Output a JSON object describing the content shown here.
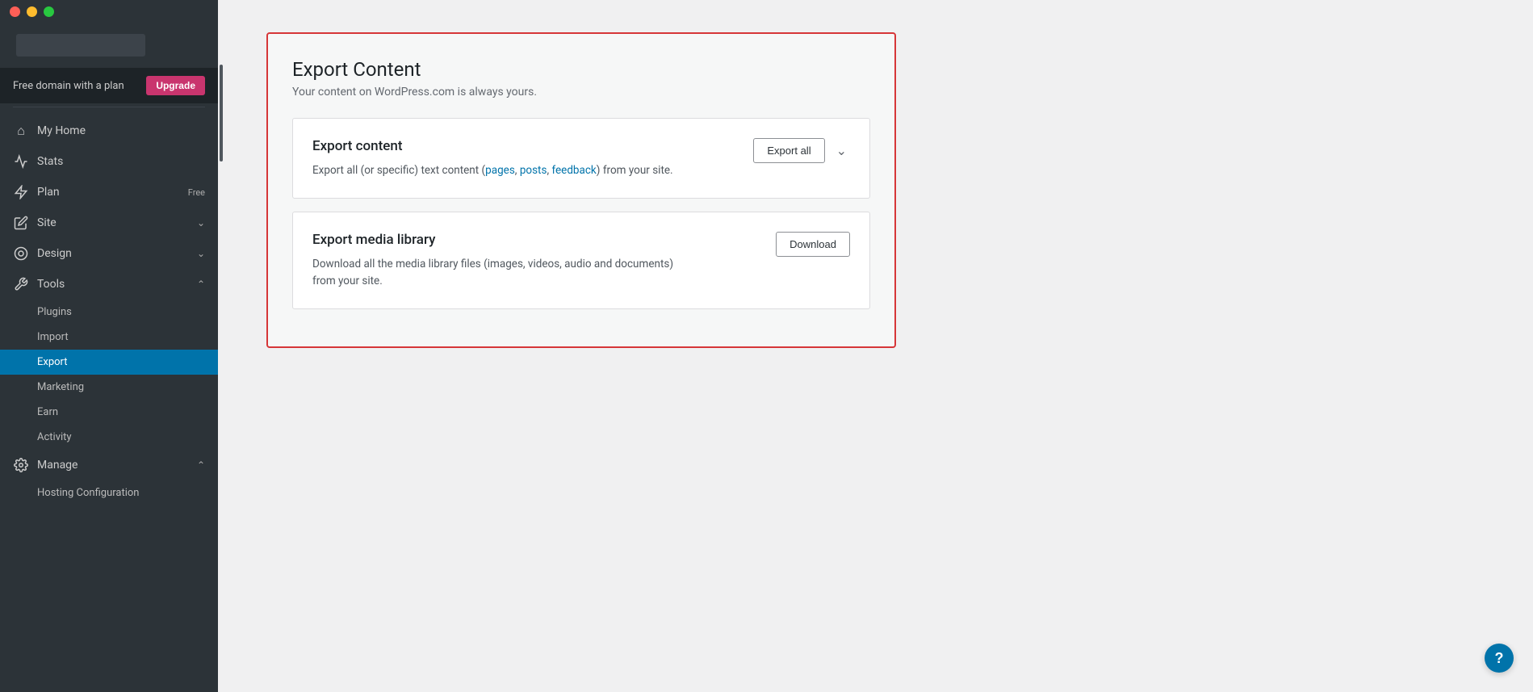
{
  "titlebar": {
    "close_label": "",
    "min_label": "",
    "max_label": ""
  },
  "sidebar": {
    "upgrade_bar": {
      "text": "Free domain with a plan",
      "button_label": "Upgrade"
    },
    "nav_items": [
      {
        "id": "my-home",
        "icon": "⌂",
        "label": "My Home",
        "badge": "",
        "has_chevron": false,
        "active": false
      },
      {
        "id": "stats",
        "icon": "📊",
        "label": "Stats",
        "badge": "",
        "has_chevron": false,
        "active": false
      },
      {
        "id": "plan",
        "icon": "⚡",
        "label": "Plan",
        "badge": "Free",
        "has_chevron": false,
        "active": false
      },
      {
        "id": "site",
        "icon": "✏",
        "label": "Site",
        "badge": "",
        "has_chevron": true,
        "active": false
      },
      {
        "id": "design",
        "icon": "🎨",
        "label": "Design",
        "badge": "",
        "has_chevron": true,
        "active": false
      },
      {
        "id": "tools",
        "icon": "🔧",
        "label": "Tools",
        "badge": "",
        "has_chevron": true,
        "expanded": true,
        "active": false
      }
    ],
    "tools_sub_items": [
      {
        "id": "plugins",
        "label": "Plugins",
        "active": false
      },
      {
        "id": "import",
        "label": "Import",
        "active": false
      },
      {
        "id": "export",
        "label": "Export",
        "active": true
      },
      {
        "id": "marketing",
        "label": "Marketing",
        "active": false
      },
      {
        "id": "earn",
        "label": "Earn",
        "active": false
      },
      {
        "id": "activity",
        "label": "Activity",
        "active": false
      }
    ],
    "manage": {
      "label": "Manage",
      "has_chevron": true,
      "sub_items": [
        {
          "id": "hosting-config",
          "label": "Hosting Configuration",
          "active": false
        }
      ]
    }
  },
  "main": {
    "export_content": {
      "title": "Export Content",
      "subtitle": "Your content on WordPress.com is always yours.",
      "cards": [
        {
          "id": "export-content",
          "title": "Export content",
          "description": "Export all (or specific) text content (pages, posts, feedback) from your site.",
          "description_linked": [
            "pages",
            "posts",
            "feedback"
          ],
          "button_label": "Export all",
          "has_chevron": true
        },
        {
          "id": "export-media",
          "title": "Export media library",
          "description": "Download all the media library files (images, videos, audio and documents) from your site.",
          "description_linked": [],
          "button_label": "Download",
          "has_chevron": false
        }
      ]
    }
  },
  "help_button": {
    "label": "?"
  }
}
